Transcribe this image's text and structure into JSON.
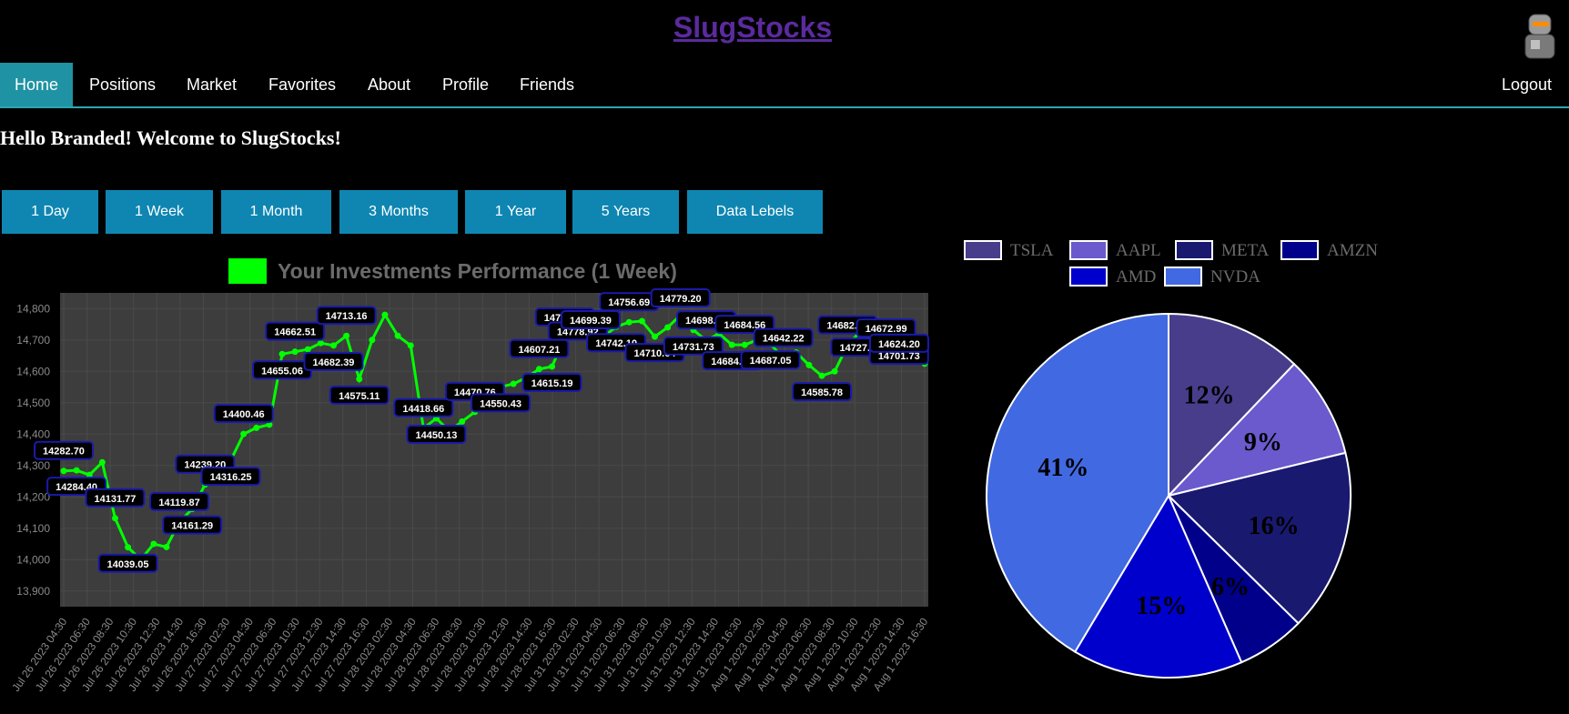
{
  "app": {
    "title": "SlugStocks",
    "greeting": "Hello Branded! Welcome to SlugStocks!"
  },
  "nav": {
    "items": [
      "Home",
      "Positions",
      "Market",
      "Favorites",
      "About",
      "Profile",
      "Friends"
    ],
    "active": "Home",
    "logout": "Logout"
  },
  "range_buttons": [
    "1 Day",
    "1 Week",
    "1 Month",
    "3 Months",
    "1 Year",
    "5 Years",
    "Data Lebels"
  ],
  "chart_data": [
    {
      "type": "line",
      "title": "Your Investments Performance (1 Week)",
      "legend": [
        {
          "name": "Your Investments Performance (1 Week)",
          "color": "#00ff00"
        }
      ],
      "ylim": [
        13850,
        14850
      ],
      "y_ticks": [
        "13,900",
        "14,000",
        "14,100",
        "14,200",
        "14,300",
        "14,400",
        "14,500",
        "14,600",
        "14,700",
        "14,800"
      ],
      "x_tick_labels": [
        "Jul 26 2023 04:30",
        "Jul 26 2023 06:30",
        "Jul 26 2023 08:30",
        "Jul 26 2023 10:30",
        "Jul 26 2023 12:30",
        "Jul 26 2023 14:30",
        "Jul 26 2023 16:30",
        "Jul 27 2023 02:30",
        "Jul 27 2023 04:30",
        "Jul 27 2023 06:30",
        "Jul 27 2023 10:30",
        "Jul 27 2023 12:30",
        "Jul 27 2023 14:30",
        "Jul 27 2023 16:30",
        "Jul 28 2023 02:30",
        "Jul 28 2023 04:30",
        "Jul 28 2023 06:30",
        "Jul 28 2023 08:30",
        "Jul 28 2023 10:30",
        "Jul 28 2023 12:30",
        "Jul 28 2023 14:30",
        "Jul 28 2023 16:30",
        "Jul 31 2023 02:30",
        "Jul 31 2023 04:30",
        "Jul 31 2023 06:30",
        "Jul 31 2023 08:30",
        "Jul 31 2023 10:30",
        "Jul 31 2023 12:30",
        "Jul 31 2023 14:30",
        "Jul 31 2023 16:30",
        "Aug 1 2023 02:30",
        "Aug 1 2023 04:30",
        "Aug 1 2023 06:30",
        "Aug 1 2023 08:30",
        "Aug 1 2023 10:30",
        "Aug 1 2023 12:30",
        "Aug 1 2023 14:30",
        "Aug 1 2023 16:30"
      ],
      "series": [
        {
          "color": "#00ff00",
          "values": [
            14282.7,
            14284.4,
            14270,
            14310,
            14131.77,
            14039.05,
            14000,
            14050,
            14040,
            14119.87,
            14161.29,
            14239.2,
            14250,
            14316.25,
            14400.46,
            14420,
            14430,
            14655.06,
            14662.51,
            14670,
            14690,
            14682.39,
            14713.16,
            14575.11,
            14700,
            14780,
            14713.16,
            14682.39,
            14418.66,
            14450.13,
            14410,
            14440,
            14470.76,
            14500,
            14550.43,
            14560,
            14580,
            14607.21,
            14615.19,
            14708.02,
            14778.92,
            14699.39,
            14710,
            14742.1,
            14756.69,
            14760,
            14710.64,
            14740,
            14779.2,
            14731.73,
            14698.58,
            14720,
            14684.5,
            14684.56,
            14700,
            14687.05,
            14642.22,
            14660,
            14620,
            14585.78,
            14600,
            14682.81,
            14727.54,
            14700,
            14672.99,
            14701.73,
            14650,
            14624.2
          ]
        }
      ],
      "data_labels": [
        {
          "i": 0,
          "text": "14282.70"
        },
        {
          "i": 1,
          "text": "14284.40"
        },
        {
          "i": 4,
          "text": "14131.77"
        },
        {
          "i": 5,
          "text": "14039.05"
        },
        {
          "i": 9,
          "text": "14119.87"
        },
        {
          "i": 10,
          "text": "14161.29"
        },
        {
          "i": 11,
          "text": "14239.20"
        },
        {
          "i": 13,
          "text": "14316.25"
        },
        {
          "i": 14,
          "text": "14400.46"
        },
        {
          "i": 17,
          "text": "14655.06"
        },
        {
          "i": 18,
          "text": "14662.51"
        },
        {
          "i": 21,
          "text": "14682.39"
        },
        {
          "i": 22,
          "text": "14713.16"
        },
        {
          "i": 23,
          "text": "14575.11"
        },
        {
          "i": 28,
          "text": "14418.66"
        },
        {
          "i": 29,
          "text": "14450.13"
        },
        {
          "i": 32,
          "text": "14470.76"
        },
        {
          "i": 34,
          "text": "14550.43"
        },
        {
          "i": 37,
          "text": "14607.21"
        },
        {
          "i": 38,
          "text": "14615.19"
        },
        {
          "i": 39,
          "text": "14708.02"
        },
        {
          "i": 40,
          "text": "14778.92"
        },
        {
          "i": 41,
          "text": "14699.39"
        },
        {
          "i": 43,
          "text": "14742.10"
        },
        {
          "i": 44,
          "text": "14756.69"
        },
        {
          "i": 46,
          "text": "14710.64"
        },
        {
          "i": 48,
          "text": "14779.20"
        },
        {
          "i": 49,
          "text": "14731.73"
        },
        {
          "i": 50,
          "text": "14698.58"
        },
        {
          "i": 52,
          "text": "14684.50"
        },
        {
          "i": 53,
          "text": "14684.56"
        },
        {
          "i": 55,
          "text": "14687.05"
        },
        {
          "i": 56,
          "text": "14642.22"
        },
        {
          "i": 59,
          "text": "14585.78"
        },
        {
          "i": 61,
          "text": "14682.81"
        },
        {
          "i": 62,
          "text": "14727.54"
        },
        {
          "i": 64,
          "text": "14672.99"
        },
        {
          "i": 65,
          "text": "14701.73"
        },
        {
          "i": 67,
          "text": "14624.20"
        }
      ]
    },
    {
      "type": "pie",
      "slices": [
        {
          "label": "TSLA",
          "value": 12,
          "text": "12%",
          "color": "#483d8b"
        },
        {
          "label": "AAPL",
          "value": 9,
          "text": "9%",
          "color": "#6a5acd"
        },
        {
          "label": "META",
          "value": 16,
          "text": "16%",
          "color": "#191970"
        },
        {
          "label": "AMZN",
          "value": 6,
          "text": "6%",
          "color": "#00008b"
        },
        {
          "label": "AMD",
          "value": 15,
          "text": "15%",
          "color": "#0000cd"
        },
        {
          "label": "NVDA",
          "value": 41,
          "text": "41%",
          "color": "#4169e1"
        }
      ],
      "legend_placement": "top"
    }
  ]
}
